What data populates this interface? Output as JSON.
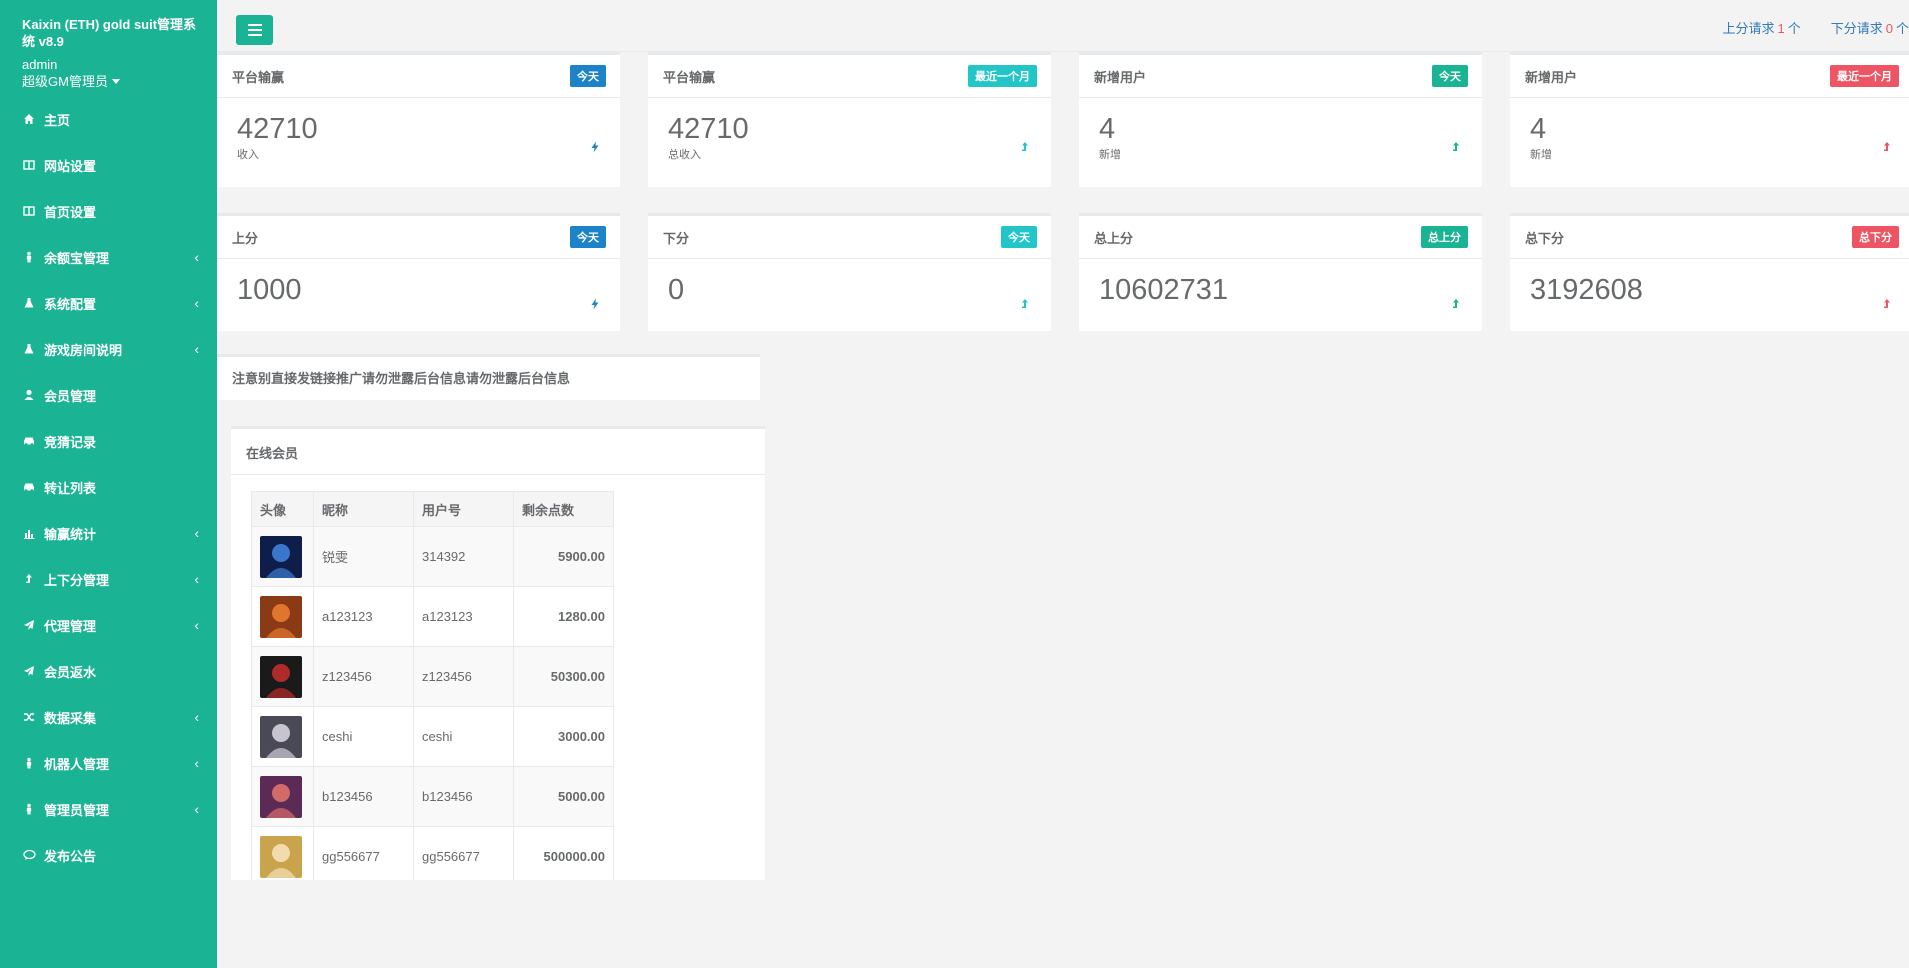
{
  "app": {
    "title": "Kaixin (ETH) gold suit管理系统 v8.9",
    "user": "admin",
    "role": "超级GM管理员"
  },
  "nav": [
    {
      "label": "主页",
      "icon": "home-icon",
      "has_arrow": false
    },
    {
      "label": "网站设置",
      "icon": "columns-icon",
      "has_arrow": false
    },
    {
      "label": "首页设置",
      "icon": "columns-icon",
      "has_arrow": false
    },
    {
      "label": "余额宝管理",
      "icon": "user-male-icon",
      "has_arrow": true
    },
    {
      "label": "系统配置",
      "icon": "flask-icon",
      "has_arrow": true
    },
    {
      "label": "游戏房间说明",
      "icon": "flask-icon",
      "has_arrow": true
    },
    {
      "label": "会员管理",
      "icon": "user-icon",
      "has_arrow": false
    },
    {
      "label": "竞猜记录",
      "icon": "car-icon",
      "has_arrow": false
    },
    {
      "label": "转让列表",
      "icon": "car-icon",
      "has_arrow": false
    },
    {
      "label": "输赢统计",
      "icon": "bar-chart-icon",
      "has_arrow": true
    },
    {
      "label": "上下分管理",
      "icon": "level-up-icon",
      "has_arrow": true
    },
    {
      "label": "代理管理",
      "icon": "paper-plane-icon",
      "has_arrow": true
    },
    {
      "label": "会员返水",
      "icon": "paper-plane-icon",
      "has_arrow": false
    },
    {
      "label": "数据采集",
      "icon": "shuffle-icon",
      "has_arrow": true
    },
    {
      "label": "机器人管理",
      "icon": "user-male-icon",
      "has_arrow": true
    },
    {
      "label": "管理员管理",
      "icon": "user-male-icon",
      "has_arrow": true
    },
    {
      "label": "发布公告",
      "icon": "comments-icon",
      "has_arrow": false
    }
  ],
  "topbar": {
    "up_label": "上分请求",
    "up_count": "1",
    "down_label": "下分请求",
    "down_count": "0",
    "unit": "个"
  },
  "widgets": [
    {
      "title": "平台输赢",
      "badge": "今天",
      "badge_color": "#1c84c6",
      "value": "42710",
      "sub": "收入",
      "stat_icon": "bolt-icon"
    },
    {
      "title": "平台输赢",
      "badge": "最近一个月",
      "badge_color": "#23c6c8",
      "value": "42710",
      "sub": "总收入",
      "stat_icon": "level-up-icon"
    },
    {
      "title": "新增用户",
      "badge": "今天",
      "badge_color": "#1ab394",
      "value": "4",
      "sub": "新增",
      "stat_icon": "level-up-icon"
    },
    {
      "title": "新增用户",
      "badge": "最近一个月",
      "badge_color": "#ed5565",
      "value": "4",
      "sub": "新增",
      "stat_icon": "level-up-icon"
    },
    {
      "title": "上分",
      "badge": "今天",
      "badge_color": "#1c84c6",
      "value": "1000",
      "sub": "",
      "stat_icon": "bolt-icon"
    },
    {
      "title": "下分",
      "badge": "今天",
      "badge_color": "#23c6c8",
      "value": "0",
      "sub": "",
      "stat_icon": "level-up-icon"
    },
    {
      "title": "总上分",
      "badge": "总上分",
      "badge_color": "#1ab394",
      "value": "10602731",
      "sub": "",
      "stat_icon": "level-up-icon"
    },
    {
      "title": "总下分",
      "badge": "总下分",
      "badge_color": "#ed5565",
      "value": "3192608",
      "sub": "",
      "stat_icon": "level-up-icon"
    }
  ],
  "notice": "注意别直接发链接推广请勿泄露后台信息请勿泄露后台信息",
  "online": {
    "title": "在线会员",
    "columns": [
      "头像",
      "昵称",
      "用户号",
      "剩余点数"
    ],
    "rows": [
      {
        "nickname": "锐雯",
        "user_id": "314392",
        "points": "5900.00",
        "avatar_colors": [
          "#0f1d4a",
          "#3a76c9"
        ]
      },
      {
        "nickname": "a123123",
        "user_id": "a123123",
        "points": "1280.00",
        "avatar_colors": [
          "#8a3b16",
          "#e0752d"
        ]
      },
      {
        "nickname": "z123456",
        "user_id": "z123456",
        "points": "50300.00",
        "avatar_colors": [
          "#1a1a1a",
          "#b02a2a"
        ]
      },
      {
        "nickname": "ceshi",
        "user_id": "ceshi",
        "points": "3000.00",
        "avatar_colors": [
          "#4a4a56",
          "#c7c4cf"
        ]
      },
      {
        "nickname": "b123456",
        "user_id": "b123456",
        "points": "5000.00",
        "avatar_colors": [
          "#5b2a55",
          "#d26a6a"
        ]
      },
      {
        "nickname": "gg556677",
        "user_id": "gg556677",
        "points": "500000.00",
        "avatar_colors": [
          "#c9a44d",
          "#f1dcb0"
        ]
      }
    ]
  }
}
